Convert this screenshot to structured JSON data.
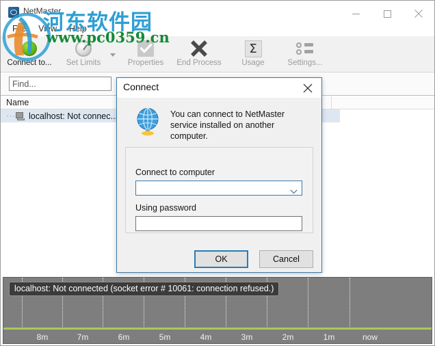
{
  "window": {
    "title": "NetMaster",
    "icon": "netmaster-app-icon",
    "controls": {
      "minimize": "minimize-icon",
      "maximize": "maximize-icon",
      "close": "close-icon"
    }
  },
  "menu": {
    "items": [
      {
        "label": "File"
      },
      {
        "label": "View"
      },
      {
        "label": "Help"
      }
    ]
  },
  "toolbar": {
    "items": [
      {
        "label": "Connect to...",
        "icon": "green-circle-icon",
        "enabled": true
      },
      {
        "label": "Set Limits",
        "icon": "gauge-icon",
        "enabled": false
      },
      {
        "label": "Properties",
        "icon": "checkmark-icon",
        "enabled": false
      },
      {
        "label": "End Process",
        "icon": "x-cross-icon",
        "enabled": false
      },
      {
        "label": "Usage",
        "icon": "sigma-icon",
        "enabled": false
      },
      {
        "label": "Settings...",
        "icon": "settings-list-icon",
        "enabled": false
      }
    ],
    "dropdown_icon": "chevron-down-icon"
  },
  "search": {
    "value": "",
    "placeholder": "Find..."
  },
  "list": {
    "columns": [
      "Name"
    ],
    "rows": [
      {
        "icon": "computer-icon",
        "name": "localhost: Not connec..."
      }
    ]
  },
  "chart_panel": {
    "status_message": "localhost: Not connected (socket error # 10061: connection refused.)",
    "tick_labels": [
      "8m",
      "7m",
      "6m",
      "5m",
      "4m",
      "3m",
      "2m",
      "1m",
      "now"
    ],
    "axis_color": "#a7ca5a",
    "background_color": "#7e7e7e"
  },
  "dialog": {
    "title": "Connect",
    "close_icon": "close-icon",
    "icon": "globe-icon",
    "message": "You can connect to NetMaster service installed on another computer.",
    "fields": [
      {
        "label": "Connect to computer",
        "type": "combobox",
        "value": "",
        "placeholder": "",
        "arrow_icon": "chevron-down-icon"
      },
      {
        "label": "Using password",
        "type": "textbox",
        "value": "",
        "placeholder": ""
      }
    ],
    "buttons": [
      {
        "label": "OK",
        "primary": true
      },
      {
        "label": "Cancel",
        "primary": false
      }
    ]
  },
  "watermark": {
    "chinese": "河东软件园",
    "url": "www.pc0359.cn"
  }
}
